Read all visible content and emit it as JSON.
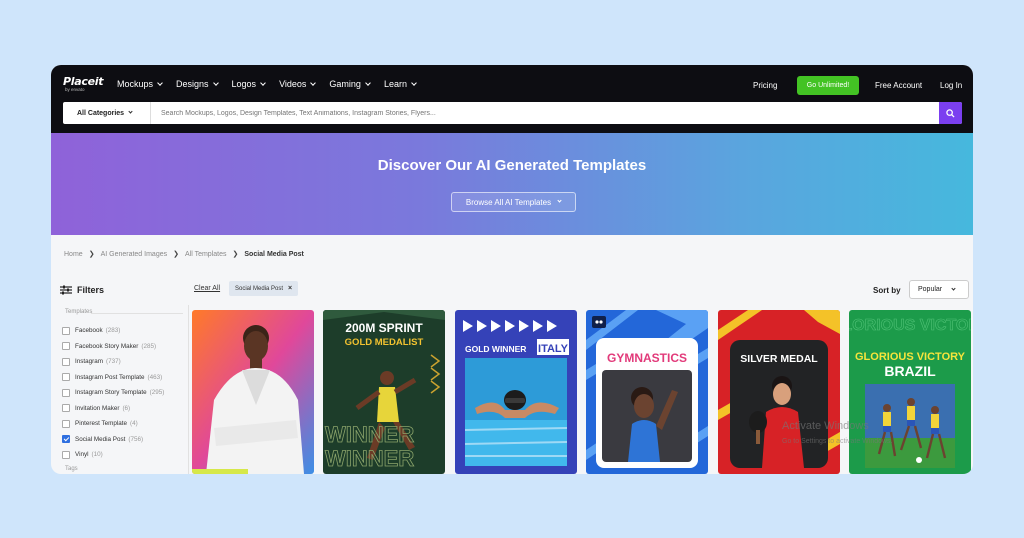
{
  "logo": {
    "text": "Placeit",
    "sub": "by envato"
  },
  "nav": [
    {
      "label": "Mockups"
    },
    {
      "label": "Designs"
    },
    {
      "label": "Logos"
    },
    {
      "label": "Videos"
    },
    {
      "label": "Gaming"
    },
    {
      "label": "Learn"
    }
  ],
  "header": {
    "pricing": "Pricing",
    "cta": "Go Unlimited!",
    "free_account": "Free Account",
    "login": "Log In"
  },
  "search": {
    "category": "All Categories",
    "placeholder": "Search Mockups, Logos, Design Templates, Text Animations, Instagram Stories, Flyers..."
  },
  "banner": {
    "title": "Discover Our AI Generated Templates",
    "button": "Browse All AI Templates"
  },
  "breadcrumb": {
    "home": "Home",
    "ai_images": "AI Generated Images",
    "all_templates": "All Templates",
    "current": "Social Media Post"
  },
  "filters": {
    "title": "Filters",
    "clear_all": "Clear All",
    "active_chip": "Social Media Post",
    "group_label": "Templates",
    "next_group_label": "Tags",
    "items": [
      {
        "label": "Facebook",
        "count": "(283)",
        "checked": false
      },
      {
        "label": "Facebook Story Maker",
        "count": "(285)",
        "checked": false
      },
      {
        "label": "Instagram",
        "count": "(737)",
        "checked": false
      },
      {
        "label": "Instagram Post Template",
        "count": "(463)",
        "checked": false
      },
      {
        "label": "Instagram Story Template",
        "count": "(295)",
        "checked": false
      },
      {
        "label": "Invitation Maker",
        "count": "(6)",
        "checked": false
      },
      {
        "label": "Pinterest Template",
        "count": "(4)",
        "checked": false
      },
      {
        "label": "Social Media Post",
        "count": "(756)",
        "checked": true
      },
      {
        "label": "Vinyl",
        "count": "(10)",
        "checked": false
      }
    ]
  },
  "sort": {
    "label": "Sort by",
    "value": "Popular"
  },
  "cards": [
    {
      "title": ""
    },
    {
      "title": "200M SPRINT",
      "subtitle": "GOLD MEDALIST",
      "bottom": "WINNER"
    },
    {
      "title": "GOLD WINNER",
      "country": "ITALY"
    },
    {
      "title": "GYMNASTICS"
    },
    {
      "title": "SILVER MEDAL"
    },
    {
      "title": "GLORIOUS VICTORY",
      "country": "BRAZIL"
    }
  ],
  "watermark": {
    "line1": "Activate Windows",
    "line2": "Go to Settings to activate Windows."
  }
}
